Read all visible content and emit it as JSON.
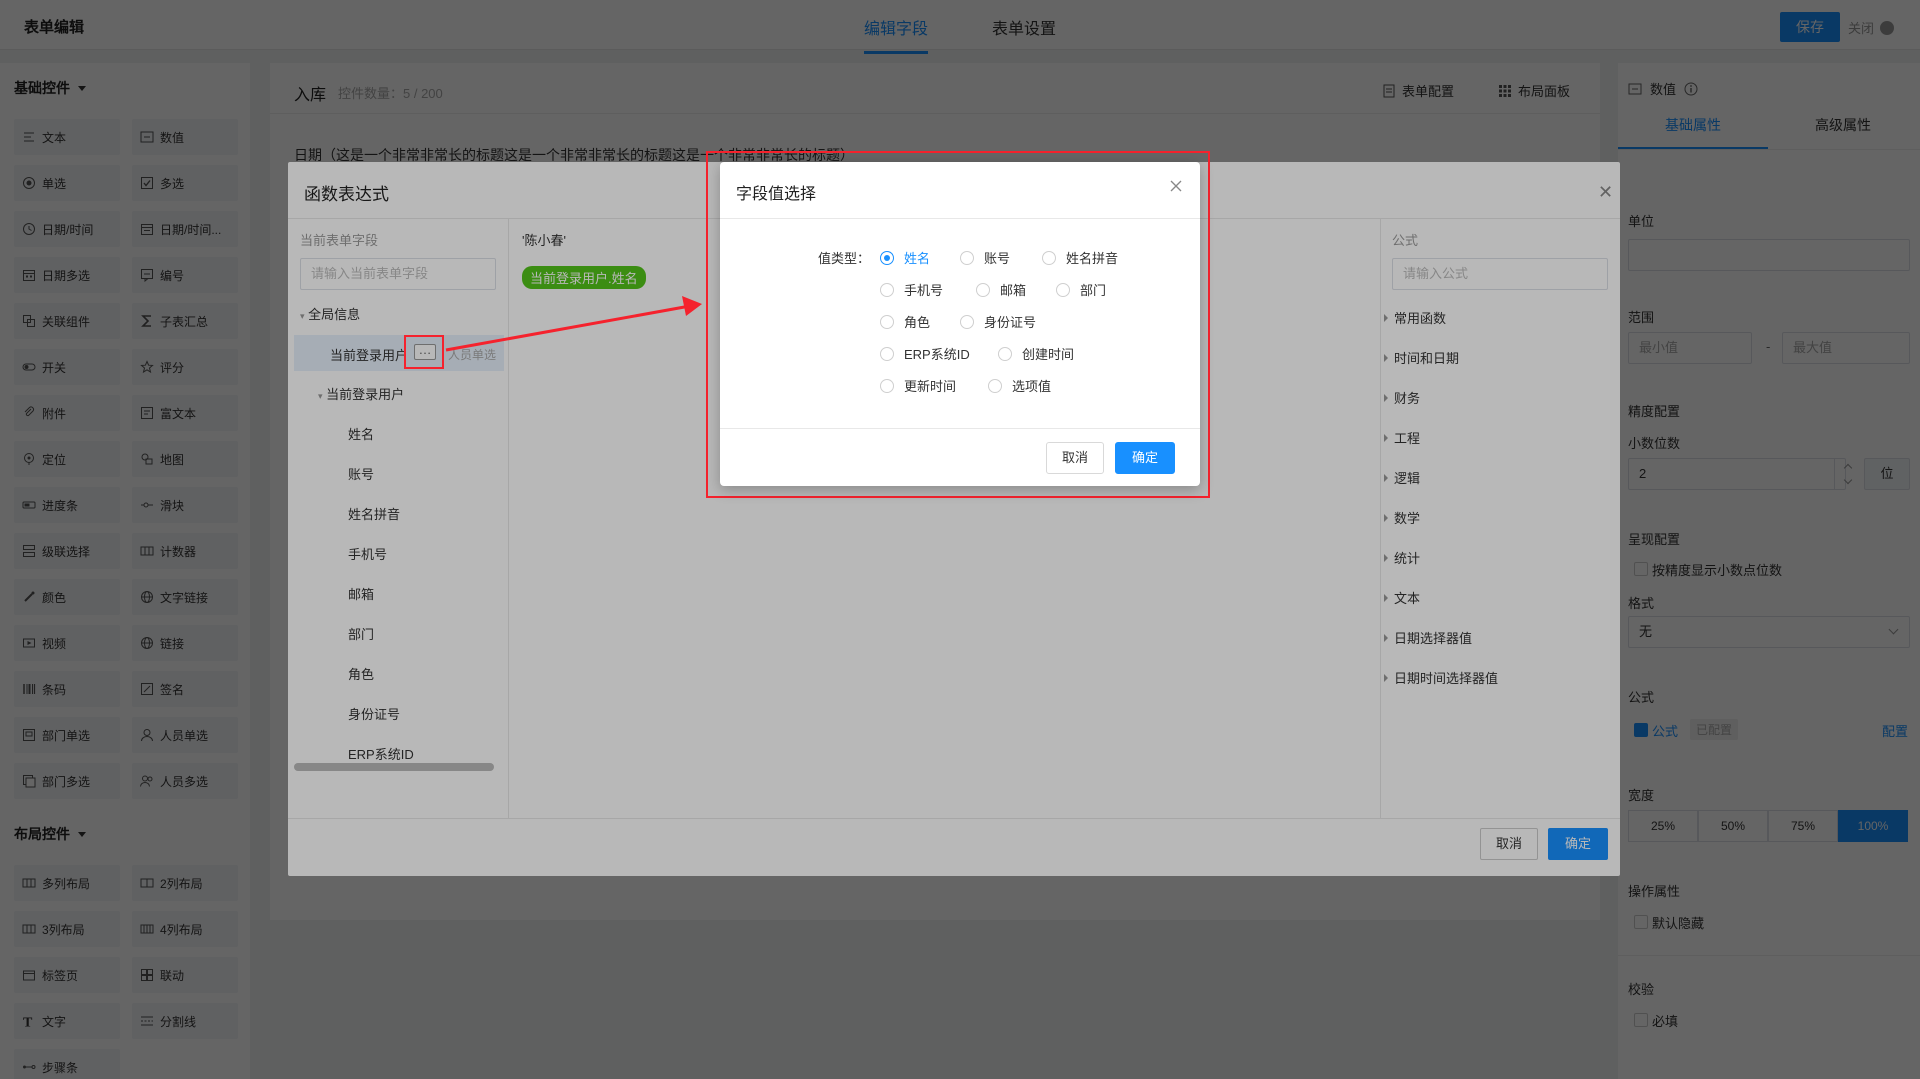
{
  "header": {
    "app_title": "表单编辑",
    "tabs": [
      "编辑字段",
      "表单设置"
    ],
    "save": "保存",
    "close": "关闭"
  },
  "left_panel": {
    "basic_title": "基础控件",
    "basic_controls": [
      {
        "label": "文本",
        "icon": "text-icon"
      },
      {
        "label": "数值",
        "icon": "number-icon"
      },
      {
        "label": "单选",
        "icon": "radio-icon"
      },
      {
        "label": "多选",
        "icon": "checkbox-icon"
      },
      {
        "label": "日期/时间",
        "icon": "clock-icon"
      },
      {
        "label": "日期/时间...",
        "icon": "calendar-range-icon"
      },
      {
        "label": "日期多选",
        "icon": "calendar-icon"
      },
      {
        "label": "编号",
        "icon": "serial-icon"
      },
      {
        "label": "关联组件",
        "icon": "link-component-icon"
      },
      {
        "label": "子表汇总",
        "icon": "sigma-icon"
      },
      {
        "label": "开关",
        "icon": "switch-icon"
      },
      {
        "label": "评分",
        "icon": "star-icon"
      },
      {
        "label": "附件",
        "icon": "paperclip-icon"
      },
      {
        "label": "富文本",
        "icon": "richtext-icon"
      },
      {
        "label": "定位",
        "icon": "location-icon"
      },
      {
        "label": "地图",
        "icon": "map-icon"
      },
      {
        "label": "进度条",
        "icon": "progress-icon"
      },
      {
        "label": "滑块",
        "icon": "slider-icon"
      },
      {
        "label": "级联选择",
        "icon": "cascade-icon"
      },
      {
        "label": "计数器",
        "icon": "counter-icon"
      },
      {
        "label": "颜色",
        "icon": "color-picker-icon"
      },
      {
        "label": "文字链接",
        "icon": "globe-icon"
      },
      {
        "label": "视频",
        "icon": "video-icon"
      },
      {
        "label": "链接",
        "icon": "globe-icon"
      },
      {
        "label": "条码",
        "icon": "barcode-icon"
      },
      {
        "label": "签名",
        "icon": "signature-icon"
      },
      {
        "label": "部门单选",
        "icon": "department-icon"
      },
      {
        "label": "人员单选",
        "icon": "user-icon"
      },
      {
        "label": "部门多选",
        "icon": "departments-icon"
      },
      {
        "label": "人员多选",
        "icon": "users-icon"
      }
    ],
    "layout_title": "布局控件",
    "layout_controls": [
      {
        "label": "多列布局",
        "icon": "columns-icon"
      },
      {
        "label": "2列布局",
        "icon": "two-columns-icon"
      },
      {
        "label": "3列布局",
        "icon": "three-columns-icon"
      },
      {
        "label": "4列布局",
        "icon": "four-columns-icon"
      },
      {
        "label": "标签页",
        "icon": "tabs-icon"
      },
      {
        "label": "联动",
        "icon": "linkage-icon"
      },
      {
        "label": "文字",
        "icon": "text-t-icon"
      },
      {
        "label": "分割线",
        "icon": "divider-icon"
      },
      {
        "label": "步骤条",
        "icon": "steps-icon"
      }
    ]
  },
  "canvas": {
    "title": "入库",
    "count": "控件数量：5 / 200",
    "form_config": "表单配置",
    "layout_panel": "布局面板",
    "long_label": "日期（这是一个非常非常长的标题这是一个非常非常长的标题这是一个非常非常长的标题）"
  },
  "right_panel": {
    "field_type": "数值",
    "tabs": [
      "基础属性",
      "高级属性"
    ],
    "unit_label": "单位",
    "range_label": "范围",
    "min_placeholder": "最小值",
    "range_sep": "-",
    "max_placeholder": "最大值",
    "precision_title": "精度配置",
    "decimals_label": "小数位数",
    "decimals_value": "2",
    "decimals_unit": "位",
    "display_title": "呈现配置",
    "show_decimals": "按精度显示小数点位数",
    "format_label": "格式",
    "format_value": "无",
    "formula_title": "公式",
    "formula_check": "公式",
    "formula_badge": "已配置",
    "formula_config": "配置",
    "width_title": "宽度",
    "widths": [
      "25%",
      "50%",
      "75%",
      "100%"
    ],
    "width_selected": "100%",
    "ops_title": "操作属性",
    "default_hidden": "默认隐藏",
    "validation_title": "校验",
    "required": "必填"
  },
  "formula_dialog": {
    "title": "函数表达式",
    "left_title": "当前表单字段",
    "left_placeholder": "请输入当前表单字段",
    "tree": {
      "root": "全局信息",
      "selected": "当前登录用户",
      "selected_hint": "人员单选",
      "group": "当前登录用户",
      "children": [
        "姓名",
        "账号",
        "姓名拼音",
        "手机号",
        "邮箱",
        "部门",
        "角色",
        "身份证号",
        "ERP系统ID"
      ]
    },
    "expression_text": "'陈小春'",
    "expression_chip": "当前登录用户.姓名",
    "right_title": "公式",
    "right_placeholder": "请输入公式",
    "categories": [
      "常用函数",
      "时间和日期",
      "财务",
      "工程",
      "逻辑",
      "数学",
      "统计",
      "文本",
      "日期选择器值",
      "日期时间选择器值"
    ],
    "cancel": "取消",
    "ok": "确定"
  },
  "field_modal": {
    "title": "字段值选择",
    "value_type_label": "值类型：",
    "options": [
      "姓名",
      "账号",
      "姓名拼音",
      "手机号",
      "邮箱",
      "部门",
      "角色",
      "身份证号",
      "ERP系统ID",
      "创建时间",
      "更新时间",
      "选项值"
    ],
    "selected": "姓名",
    "cancel": "取消",
    "ok": "确定"
  },
  "colors": {
    "primary": "#1890ff",
    "highlight_red": "#f5222d",
    "chip_green": "#52c41a"
  }
}
